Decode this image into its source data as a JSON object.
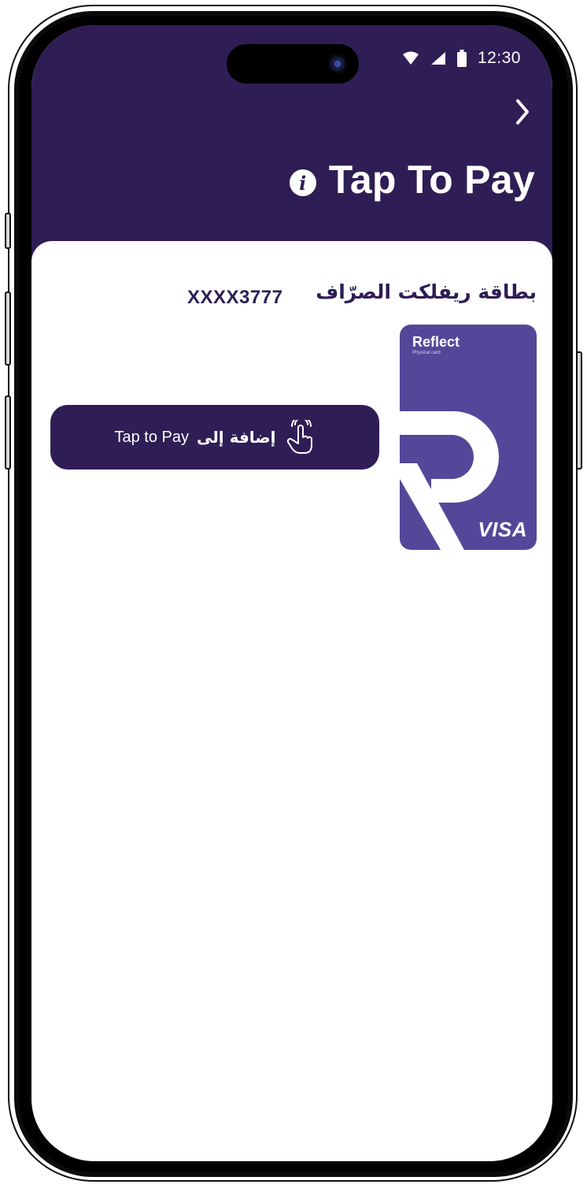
{
  "status_bar": {
    "time": "12:30",
    "icons": [
      "wifi-icon",
      "cellular-signal-icon",
      "battery-icon"
    ]
  },
  "header": {
    "back_icon": "chevron-right-icon",
    "title": "Tap To Pay",
    "info_icon": "info-icon",
    "info_glyph": "i"
  },
  "card_section": {
    "card_name": "بطاقة ريفلكت الصرّاف",
    "card_number": "XXXX3777",
    "card_image": {
      "brand": "Reflect",
      "subtitle": "Physical card",
      "network": "VISA"
    }
  },
  "tap_button": {
    "label_ar": "إضافة إلى",
    "label_en": "Tap to Pay",
    "icon": "tap-hand-icon"
  },
  "colors": {
    "header_bg": "#2e1e55",
    "card_bg": "#54479a",
    "text_primary": "#2e1e55",
    "screen_bg": "#ffffff"
  }
}
